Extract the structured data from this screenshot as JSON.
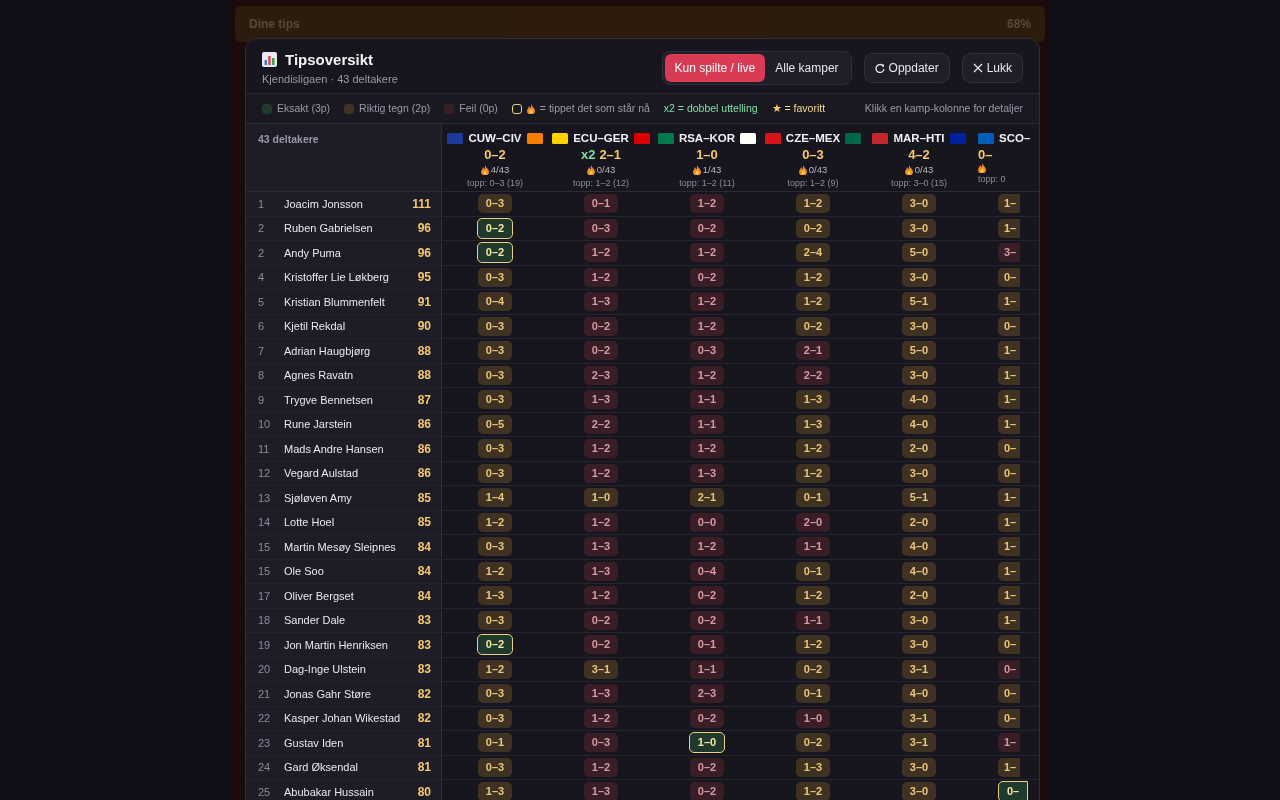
{
  "backdrop": {
    "title": "Dine tips",
    "percent": "68%"
  },
  "modal": {
    "title": "Tipsoversikt",
    "subtitle": "Kjendisligaen · 43 deltakere",
    "filters": [
      {
        "label": "Kun spilte / live",
        "selected": true
      },
      {
        "label": "Alle kamper",
        "selected": false
      }
    ],
    "buttons": [
      {
        "kind": "refresh",
        "label": "Oppdater"
      },
      {
        "kind": "close",
        "label": "Lukk"
      }
    ]
  },
  "legend": {
    "results": [
      {
        "label": "Eksakt (3p)",
        "color": "#1f3a2c"
      },
      {
        "label": "Riktig tegn (2p)",
        "color": "#3f3222"
      },
      {
        "label": "Feil (0p)",
        "color": "#3a1e27"
      }
    ],
    "current": "= tippet det som står nå",
    "double": "x2 = dobbel uttelling",
    "favorite_star": "★",
    "favorite": "= favoritt",
    "hint": "Klikk en kamp-kolonne for detaljer"
  },
  "table": {
    "count_label": "43 deltakere",
    "matches": [
      {
        "code": "CUW–CIV",
        "flags": [
          {
            "color": "#1a3a9c"
          },
          {
            "color": "#f77f00"
          }
        ],
        "score": "0–2",
        "hits": "4/43",
        "top": "topp: 0–3 (19)"
      },
      {
        "code": "ECU–GER",
        "flags": [
          {
            "color": "#ffd100"
          },
          {
            "color": "#dd0000"
          }
        ],
        "multiplier": "x2",
        "score": "2–1",
        "hits": "0/43",
        "top": "topp: 1–2 (12)"
      },
      {
        "code": "RSA–KOR",
        "flags": [
          {
            "color": "#007a4d"
          },
          {
            "color": "#ffffff"
          }
        ],
        "score": "1–0",
        "hits": "1/43",
        "top": "topp: 1–2 (11)"
      },
      {
        "code": "CZE–MEX",
        "flags": [
          {
            "color": "#d7141a"
          },
          {
            "color": "#006847"
          }
        ],
        "score": "0–3",
        "hits": "0/43",
        "top": "topp: 1–2 (9)"
      },
      {
        "code": "MAR–HTI",
        "flags": [
          {
            "color": "#c1272d"
          },
          {
            "color": "#00209f"
          }
        ],
        "score": "4–2",
        "hits": "0/43",
        "top": "topp: 3–0 (15)"
      },
      {
        "code": "SCO–",
        "flags": [
          {
            "color": "#005eb8"
          }
        ],
        "score": "0–",
        "top": "topp: 0"
      }
    ],
    "rows": [
      {
        "rank": "1",
        "name": "Joacim Jonsson",
        "points": "111",
        "tips": [
          {
            "tip": "0–3",
            "kind": "sign",
            "current": false
          },
          {
            "tip": "0–1",
            "kind": "wrong",
            "current": false
          },
          {
            "tip": "1–2",
            "kind": "wrong",
            "current": false
          },
          {
            "tip": "1–2",
            "kind": "sign",
            "current": false
          },
          {
            "tip": "3–0",
            "kind": "sign",
            "current": false
          },
          {
            "tip": "1–",
            "kind": "sign",
            "current": false
          }
        ]
      },
      {
        "rank": "2",
        "name": "Ruben Gabrielsen",
        "points": "96",
        "tips": [
          {
            "tip": "0–2",
            "kind": "exact",
            "current": true
          },
          {
            "tip": "0–3",
            "kind": "wrong",
            "current": false
          },
          {
            "tip": "0–2",
            "kind": "wrong",
            "current": false
          },
          {
            "tip": "0–2",
            "kind": "sign",
            "current": false
          },
          {
            "tip": "3–0",
            "kind": "sign",
            "current": false
          },
          {
            "tip": "1–",
            "kind": "sign",
            "current": false
          }
        ]
      },
      {
        "rank": "2",
        "name": "Andy Puma",
        "points": "96",
        "tips": [
          {
            "tip": "0–2",
            "kind": "exact",
            "current": true
          },
          {
            "tip": "1–2",
            "kind": "wrong",
            "current": false
          },
          {
            "tip": "1–2",
            "kind": "wrong",
            "current": false
          },
          {
            "tip": "2–4",
            "kind": "sign",
            "current": false
          },
          {
            "tip": "5–0",
            "kind": "sign",
            "current": false
          },
          {
            "tip": "3–",
            "kind": "wrong",
            "current": false
          }
        ]
      },
      {
        "rank": "4",
        "name": "Kristoffer Lie Løkberg",
        "points": "95",
        "tips": [
          {
            "tip": "0–3",
            "kind": "sign",
            "current": false
          },
          {
            "tip": "1–2",
            "kind": "wrong",
            "current": false
          },
          {
            "tip": "0–2",
            "kind": "wrong",
            "current": false
          },
          {
            "tip": "1–2",
            "kind": "sign",
            "current": false
          },
          {
            "tip": "3–0",
            "kind": "sign",
            "current": false
          },
          {
            "tip": "0–",
            "kind": "sign",
            "current": false
          }
        ]
      },
      {
        "rank": "5",
        "name": "Kristian Blummenfelt",
        "points": "91",
        "tips": [
          {
            "tip": "0–4",
            "kind": "sign",
            "current": false
          },
          {
            "tip": "1–3",
            "kind": "wrong",
            "current": false
          },
          {
            "tip": "1–2",
            "kind": "wrong",
            "current": false
          },
          {
            "tip": "1–2",
            "kind": "sign",
            "current": false
          },
          {
            "tip": "5–1",
            "kind": "sign",
            "current": false
          },
          {
            "tip": "1–",
            "kind": "sign",
            "current": false
          }
        ]
      },
      {
        "rank": "6",
        "name": "Kjetil Rekdal",
        "points": "90",
        "tips": [
          {
            "tip": "0–3",
            "kind": "sign",
            "current": false
          },
          {
            "tip": "0–2",
            "kind": "wrong",
            "current": false
          },
          {
            "tip": "1–2",
            "kind": "wrong",
            "current": false
          },
          {
            "tip": "0–2",
            "kind": "sign",
            "current": false
          },
          {
            "tip": "3–0",
            "kind": "sign",
            "current": false
          },
          {
            "tip": "0–",
            "kind": "sign",
            "current": false
          }
        ]
      },
      {
        "rank": "7",
        "name": "Adrian Haugbjørg",
        "points": "88",
        "tips": [
          {
            "tip": "0–3",
            "kind": "sign",
            "current": false
          },
          {
            "tip": "0–2",
            "kind": "wrong",
            "current": false
          },
          {
            "tip": "0–3",
            "kind": "wrong",
            "current": false
          },
          {
            "tip": "2–1",
            "kind": "wrong",
            "current": false
          },
          {
            "tip": "5–0",
            "kind": "sign",
            "current": false
          },
          {
            "tip": "1–",
            "kind": "sign",
            "current": false
          }
        ]
      },
      {
        "rank": "8",
        "name": "Agnes Ravatn",
        "points": "88",
        "tips": [
          {
            "tip": "0–3",
            "kind": "sign",
            "current": false
          },
          {
            "tip": "2–3",
            "kind": "wrong",
            "current": false
          },
          {
            "tip": "1–2",
            "kind": "wrong",
            "current": false
          },
          {
            "tip": "2–2",
            "kind": "wrong",
            "current": false
          },
          {
            "tip": "3–0",
            "kind": "sign",
            "current": false
          },
          {
            "tip": "1–",
            "kind": "sign",
            "current": false
          }
        ]
      },
      {
        "rank": "9",
        "name": "Trygve Bennetsen",
        "points": "87",
        "tips": [
          {
            "tip": "0–3",
            "kind": "sign",
            "current": false
          },
          {
            "tip": "1–3",
            "kind": "wrong",
            "current": false
          },
          {
            "tip": "1–1",
            "kind": "wrong",
            "current": false
          },
          {
            "tip": "1–3",
            "kind": "sign",
            "current": false
          },
          {
            "tip": "4–0",
            "kind": "sign",
            "current": false
          },
          {
            "tip": "1–",
            "kind": "sign",
            "current": false
          }
        ]
      },
      {
        "rank": "10",
        "name": "Rune Jarstein",
        "points": "86",
        "tips": [
          {
            "tip": "0–5",
            "kind": "sign",
            "current": false
          },
          {
            "tip": "2–2",
            "kind": "wrong",
            "current": false
          },
          {
            "tip": "1–1",
            "kind": "wrong",
            "current": false
          },
          {
            "tip": "1–3",
            "kind": "sign",
            "current": false
          },
          {
            "tip": "4–0",
            "kind": "sign",
            "current": false
          },
          {
            "tip": "1–",
            "kind": "sign",
            "current": false
          }
        ]
      },
      {
        "rank": "11",
        "name": "Mads Andre Hansen",
        "points": "86",
        "tips": [
          {
            "tip": "0–3",
            "kind": "sign",
            "current": false
          },
          {
            "tip": "1–2",
            "kind": "wrong",
            "current": false
          },
          {
            "tip": "1–2",
            "kind": "wrong",
            "current": false
          },
          {
            "tip": "1–2",
            "kind": "sign",
            "current": false
          },
          {
            "tip": "2–0",
            "kind": "sign",
            "current": false
          },
          {
            "tip": "0–",
            "kind": "sign",
            "current": false
          }
        ]
      },
      {
        "rank": "12",
        "name": "Vegard Aulstad",
        "points": "86",
        "tips": [
          {
            "tip": "0–3",
            "kind": "sign",
            "current": false
          },
          {
            "tip": "1–2",
            "kind": "wrong",
            "current": false
          },
          {
            "tip": "1–3",
            "kind": "wrong",
            "current": false
          },
          {
            "tip": "1–2",
            "kind": "sign",
            "current": false
          },
          {
            "tip": "3–0",
            "kind": "sign",
            "current": false
          },
          {
            "tip": "0–",
            "kind": "sign",
            "current": false
          }
        ]
      },
      {
        "rank": "13",
        "name": "Sjøløven Amy",
        "points": "85",
        "tips": [
          {
            "tip": "1–4",
            "kind": "sign",
            "current": false
          },
          {
            "tip": "1–0",
            "kind": "sign",
            "current": false
          },
          {
            "tip": "2–1",
            "kind": "sign",
            "current": false
          },
          {
            "tip": "0–1",
            "kind": "sign",
            "current": false
          },
          {
            "tip": "5–1",
            "kind": "sign",
            "current": false
          },
          {
            "tip": "1–",
            "kind": "sign",
            "current": false
          }
        ]
      },
      {
        "rank": "14",
        "name": "Lotte Hoel",
        "points": "85",
        "tips": [
          {
            "tip": "1–2",
            "kind": "sign",
            "current": false
          },
          {
            "tip": "1–2",
            "kind": "wrong",
            "current": false
          },
          {
            "tip": "0–0",
            "kind": "wrong",
            "current": false
          },
          {
            "tip": "2–0",
            "kind": "wrong",
            "current": false
          },
          {
            "tip": "2–0",
            "kind": "sign",
            "current": false
          },
          {
            "tip": "1–",
            "kind": "sign",
            "current": false
          }
        ]
      },
      {
        "rank": "15",
        "name": "Martin Mesøy Sleipnes",
        "points": "84",
        "tips": [
          {
            "tip": "0–3",
            "kind": "sign",
            "current": false
          },
          {
            "tip": "1–3",
            "kind": "wrong",
            "current": false
          },
          {
            "tip": "1–2",
            "kind": "wrong",
            "current": false
          },
          {
            "tip": "1–1",
            "kind": "wrong",
            "current": false
          },
          {
            "tip": "4–0",
            "kind": "sign",
            "current": false
          },
          {
            "tip": "1–",
            "kind": "sign",
            "current": false
          }
        ]
      },
      {
        "rank": "15",
        "name": "Ole Soo",
        "points": "84",
        "tips": [
          {
            "tip": "1–2",
            "kind": "sign",
            "current": false
          },
          {
            "tip": "1–3",
            "kind": "wrong",
            "current": false
          },
          {
            "tip": "0–4",
            "kind": "wrong",
            "current": false
          },
          {
            "tip": "0–1",
            "kind": "sign",
            "current": false
          },
          {
            "tip": "4–0",
            "kind": "sign",
            "current": false
          },
          {
            "tip": "1–",
            "kind": "sign",
            "current": false
          }
        ]
      },
      {
        "rank": "17",
        "name": "Oliver Bergset",
        "points": "84",
        "tips": [
          {
            "tip": "1–3",
            "kind": "sign",
            "current": false
          },
          {
            "tip": "1–2",
            "kind": "wrong",
            "current": false
          },
          {
            "tip": "0–2",
            "kind": "wrong",
            "current": false
          },
          {
            "tip": "1–2",
            "kind": "sign",
            "current": false
          },
          {
            "tip": "2–0",
            "kind": "sign",
            "current": false
          },
          {
            "tip": "1–",
            "kind": "sign",
            "current": false
          }
        ]
      },
      {
        "rank": "18",
        "name": "Sander Dale",
        "points": "83",
        "tips": [
          {
            "tip": "0–3",
            "kind": "sign",
            "current": false
          },
          {
            "tip": "0–2",
            "kind": "wrong",
            "current": false
          },
          {
            "tip": "0–2",
            "kind": "wrong",
            "current": false
          },
          {
            "tip": "1–1",
            "kind": "wrong",
            "current": false
          },
          {
            "tip": "3–0",
            "kind": "sign",
            "current": false
          },
          {
            "tip": "1–",
            "kind": "sign",
            "current": false
          }
        ]
      },
      {
        "rank": "19",
        "name": "Jon Martin Henriksen",
        "points": "83",
        "tips": [
          {
            "tip": "0–2",
            "kind": "exact",
            "current": true
          },
          {
            "tip": "0–2",
            "kind": "wrong",
            "current": false
          },
          {
            "tip": "0–1",
            "kind": "wrong",
            "current": false
          },
          {
            "tip": "1–2",
            "kind": "sign",
            "current": false
          },
          {
            "tip": "3–0",
            "kind": "sign",
            "current": false
          },
          {
            "tip": "0–",
            "kind": "sign",
            "current": false
          }
        ]
      },
      {
        "rank": "20",
        "name": "Dag-Inge Ulstein",
        "points": "83",
        "tips": [
          {
            "tip": "1–2",
            "kind": "sign",
            "current": false
          },
          {
            "tip": "3–1",
            "kind": "sign",
            "current": false
          },
          {
            "tip": "1–1",
            "kind": "wrong",
            "current": false
          },
          {
            "tip": "0–2",
            "kind": "sign",
            "current": false
          },
          {
            "tip": "3–1",
            "kind": "sign",
            "current": false
          },
          {
            "tip": "0–",
            "kind": "wrong",
            "current": false
          }
        ]
      },
      {
        "rank": "21",
        "name": "Jonas Gahr Støre",
        "points": "82",
        "tips": [
          {
            "tip": "0–3",
            "kind": "sign",
            "current": false
          },
          {
            "tip": "1–3",
            "kind": "wrong",
            "current": false
          },
          {
            "tip": "2–3",
            "kind": "wrong",
            "current": false
          },
          {
            "tip": "0–1",
            "kind": "sign",
            "current": false
          },
          {
            "tip": "4–0",
            "kind": "sign",
            "current": false
          },
          {
            "tip": "0–",
            "kind": "sign",
            "current": false
          }
        ]
      },
      {
        "rank": "22",
        "name": "Kasper Johan Wikestad",
        "points": "82",
        "tips": [
          {
            "tip": "0–3",
            "kind": "sign",
            "current": false
          },
          {
            "tip": "1–2",
            "kind": "wrong",
            "current": false
          },
          {
            "tip": "0–2",
            "kind": "wrong",
            "current": false
          },
          {
            "tip": "1–0",
            "kind": "wrong",
            "current": false
          },
          {
            "tip": "3–1",
            "kind": "sign",
            "current": false
          },
          {
            "tip": "0–",
            "kind": "sign",
            "current": false
          }
        ]
      },
      {
        "rank": "23",
        "name": "Gustav Iden",
        "points": "81",
        "tips": [
          {
            "tip": "0–1",
            "kind": "sign",
            "current": false
          },
          {
            "tip": "0–3",
            "kind": "wrong",
            "current": false
          },
          {
            "tip": "1–0",
            "kind": "exact",
            "current": true
          },
          {
            "tip": "0–2",
            "kind": "sign",
            "current": false
          },
          {
            "tip": "3–1",
            "kind": "sign",
            "current": false
          },
          {
            "tip": "1–",
            "kind": "wrong",
            "current": false
          }
        ]
      },
      {
        "rank": "24",
        "name": "Gard Øksendal",
        "points": "81",
        "tips": [
          {
            "tip": "0–3",
            "kind": "sign",
            "current": false
          },
          {
            "tip": "1–2",
            "kind": "wrong",
            "current": false
          },
          {
            "tip": "0–2",
            "kind": "wrong",
            "current": false
          },
          {
            "tip": "1–3",
            "kind": "sign",
            "current": false
          },
          {
            "tip": "3–0",
            "kind": "sign",
            "current": false
          },
          {
            "tip": "1–",
            "kind": "sign",
            "current": false
          }
        ]
      },
      {
        "rank": "25",
        "name": "Abubakar Hussain",
        "points": "80",
        "tips": [
          {
            "tip": "1–3",
            "kind": "sign",
            "current": false
          },
          {
            "tip": "1–3",
            "kind": "wrong",
            "current": false
          },
          {
            "tip": "0–2",
            "kind": "wrong",
            "current": false
          },
          {
            "tip": "1–2",
            "kind": "sign",
            "current": false
          },
          {
            "tip": "3–0",
            "kind": "sign",
            "current": false
          },
          {
            "tip": "0–",
            "kind": "exact",
            "current": true
          }
        ]
      }
    ]
  }
}
